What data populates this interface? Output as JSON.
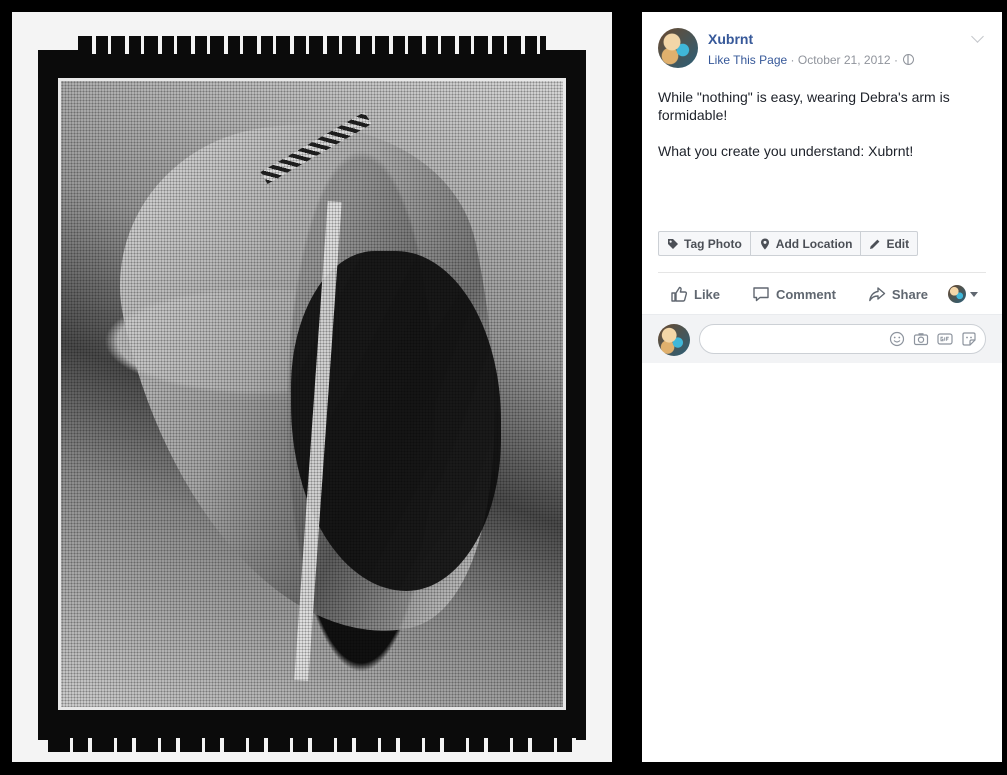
{
  "post": {
    "page_name": "Xubrnt",
    "like_page": "Like This Page",
    "date": "October 21, 2012",
    "separator": "·",
    "paragraphs": [
      "While \"nothing\" is easy, wearing Debra's arm is formidable!",
      "What you create you understand: Xubrnt!"
    ]
  },
  "photo_actions": {
    "tag": "Tag Photo",
    "location": "Add Location",
    "edit": "Edit"
  },
  "reactions": {
    "like": "Like",
    "comment": "Comment",
    "share": "Share"
  },
  "comment_box": {
    "placeholder": ""
  },
  "icons": [
    "globe-icon",
    "chevron-down-icon",
    "tag-icon",
    "location-icon",
    "pencil-icon",
    "like-icon",
    "comment-icon",
    "share-icon",
    "caret-icon",
    "emoji-icon",
    "camera-icon",
    "gif-icon",
    "sticker-icon"
  ],
  "colors": {
    "link": "#365899",
    "meta": "#90949c",
    "text": "#1d2129",
    "background": "#000000"
  }
}
